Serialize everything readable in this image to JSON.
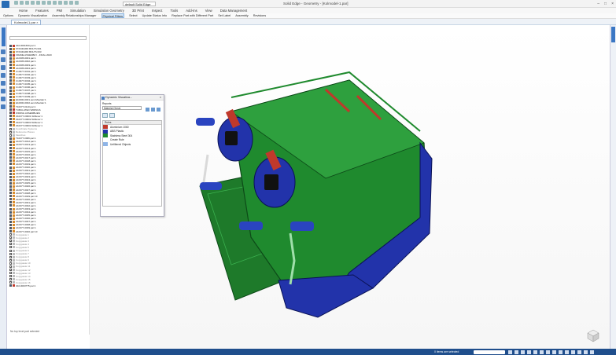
{
  "window": {
    "title": "Solid Edge - Geometry - [Kolmodel-1.par]",
    "doc_selector": "default Solid Edge"
  },
  "menu": [
    "Home",
    "Features",
    "PMI",
    "Simulation",
    "Simulation Geometry",
    "3D Print",
    "Inspect",
    "Tools",
    "Add-Ins",
    "View",
    "Data Management"
  ],
  "ribbon": [
    "Options",
    "Dynamic Visualization",
    "Assembly Relationships Manager",
    "Physical Filters",
    "Select",
    "Update Status Info",
    "Replace Part with Different Part",
    "Set Label",
    "Assembly",
    "Revisions"
  ],
  "doc_tab": "Kolmodel-1.par",
  "pathfinder": {
    "search_placeholder": "",
    "status": "No top level part selected",
    "tree": [
      {
        "t": "402-0001660.par:1",
        "s": "red",
        "c": true
      },
      {
        "t": "STANDARD BOLTS 001",
        "s": "",
        "c": true
      },
      {
        "t": "STANDARD BOLTS 003",
        "s": "",
        "c": true
      },
      {
        "t": "FRAME ASSEMBLY - FINAL 2020",
        "s": "red",
        "c": true
      },
      {
        "t": "A10305-0001.par:1",
        "s": "",
        "c": true
      },
      {
        "t": "A10305-0002.par:1",
        "s": "",
        "c": true
      },
      {
        "t": "A10305-0003.par:1",
        "s": "",
        "c": true
      },
      {
        "t": "A10305-0004.par:1",
        "s": "",
        "c": true
      },
      {
        "t": "C10377-0001.par:1",
        "s": "",
        "c": true
      },
      {
        "t": "C10377-0002.par:1",
        "s": "",
        "c": true
      },
      {
        "t": "C10377-0003.par:1",
        "s": "",
        "c": true
      },
      {
        "t": "C10377-0004.par:1",
        "s": "",
        "c": true
      },
      {
        "t": "C10377-0005.par:1",
        "s": "",
        "c": true
      },
      {
        "t": "C10377-0006.par:1",
        "s": "",
        "c": true
      },
      {
        "t": "C10377-0007.par:1",
        "s": "",
        "c": true
      },
      {
        "t": "C10377-0008.par:1",
        "s": "",
        "c": true
      },
      {
        "t": "C10377-0009.par:1",
        "s": "",
        "c": true
      },
      {
        "t": "E10000-0001.asm:Moulder:1",
        "s": "",
        "c": true
      },
      {
        "t": "E10000-0002.asm:Moulder:1",
        "s": "",
        "c": true
      },
      {
        "t": "T10377-0110.par:1",
        "s": "",
        "c": true
      },
      {
        "t": "TUBULATED WIRINGS",
        "s": "red",
        "c": true
      },
      {
        "t": "WIRING ASSEMBLIES",
        "s": "red",
        "c": true
      },
      {
        "t": "Z10377-00001.Stiffener:1",
        "s": "",
        "c": true
      },
      {
        "t": "Z10377-00002.Stiffener:1",
        "s": "",
        "c": true
      },
      {
        "t": "Z10377-00003.Stiffener:1",
        "s": "",
        "c": true
      },
      {
        "t": "Z10377-00004.Stiffener:1",
        "s": "",
        "c": true
      },
      {
        "t": "Coordinate Systems",
        "s": "grey",
        "c": false
      },
      {
        "t": "Reference Planes",
        "s": "grey",
        "c": false
      },
      {
        "t": "Sketches",
        "s": "grey",
        "c": false
      },
      {
        "t": "T10377-0006.par:1",
        "s": "",
        "c": true
      },
      {
        "t": "A10377-0012.par:1",
        "s": "",
        "c": true
      },
      {
        "t": "A10377-0013.par:1",
        "s": "",
        "c": true
      },
      {
        "t": "A10377-0014.par:1",
        "s": "",
        "c": true
      },
      {
        "t": "A10377-0015.par:1",
        "s": "",
        "c": true
      },
      {
        "t": "A10377-0016.par:1",
        "s": "",
        "c": true
      },
      {
        "t": "A10377-0017.par:1",
        "s": "",
        "c": true
      },
      {
        "t": "A10377-0018.par:1",
        "s": "",
        "c": true
      },
      {
        "t": "A10377-0019.par:1",
        "s": "",
        "c": true
      },
      {
        "t": "A10377-0020.par:1",
        "s": "",
        "c": true
      },
      {
        "t": "A10377-0021.par:1",
        "s": "",
        "c": true
      },
      {
        "t": "A10377-0022.par:1",
        "s": "",
        "c": true
      },
      {
        "t": "A10377-0023.par:1",
        "s": "",
        "c": true
      },
      {
        "t": "A10377-0024.par:1",
        "s": "",
        "c": true
      },
      {
        "t": "A10377-0025.par:1",
        "s": "",
        "c": true
      },
      {
        "t": "A10377-0026.par:1",
        "s": "",
        "c": true
      },
      {
        "t": "A10377-0027.par:1",
        "s": "",
        "c": true
      },
      {
        "t": "A10377-0028.par:1",
        "s": "",
        "c": true
      },
      {
        "t": "A10377-0029.par:10",
        "s": "",
        "c": true
      },
      {
        "t": "A10377-0030.par:1",
        "s": "",
        "c": true
      },
      {
        "t": "A10377-0031.par:1",
        "s": "",
        "c": true
      },
      {
        "t": "A10377-0032.par:1",
        "s": "",
        "c": true
      },
      {
        "t": "A10377-0033.par:1",
        "s": "",
        "c": true
      },
      {
        "t": "A10377-0034.par:1",
        "s": "",
        "c": true
      },
      {
        "t": "A10377-0035.par:1",
        "s": "",
        "c": true
      },
      {
        "t": "A10377-0036.par:1",
        "s": "",
        "c": true
      },
      {
        "t": "A10377-0037.par:1",
        "s": "",
        "c": true
      },
      {
        "t": "A10377-0038.par:1",
        "s": "",
        "c": true
      },
      {
        "t": "A10377-0039.par:1",
        "s": "",
        "c": true
      },
      {
        "t": "A10377-0040.par:10",
        "s": "",
        "c": true
      },
      {
        "t": "Copypaste 1",
        "s": "grey",
        "c": false
      },
      {
        "t": "Copypaste 2",
        "s": "grey",
        "c": false
      },
      {
        "t": "Copypaste 3",
        "s": "grey",
        "c": false
      },
      {
        "t": "Copypaste 4",
        "s": "grey",
        "c": false
      },
      {
        "t": "Copypaste 5",
        "s": "grey",
        "c": false
      },
      {
        "t": "Copypaste 6",
        "s": "grey",
        "c": false
      },
      {
        "t": "Copypaste 7",
        "s": "grey",
        "c": false
      },
      {
        "t": "Copypaste 8",
        "s": "grey",
        "c": false
      },
      {
        "t": "Copypaste 9",
        "s": "grey",
        "c": false
      },
      {
        "t": "Copypaste 10",
        "s": "grey",
        "c": false
      },
      {
        "t": "Copypaste 11",
        "s": "grey",
        "c": false
      },
      {
        "t": "Copypaste 12",
        "s": "grey",
        "c": false
      },
      {
        "t": "Copypaste 13",
        "s": "grey",
        "c": false
      },
      {
        "t": "Copypaste 14",
        "s": "grey",
        "c": false
      },
      {
        "t": "Copypaste 15",
        "s": "grey",
        "c": false
      },
      {
        "t": "Copypaste 16",
        "s": "grey",
        "c": false
      },
      {
        "t": "402-0003775.par:1",
        "s": "red",
        "c": true
      }
    ]
  },
  "dynamic_panel": {
    "title": "Dynamic Visualiza...",
    "reports_label": "Reports",
    "report_value": "Material Check",
    "list_header": "Rules",
    "items": [
      {
        "label": "Aluminium 1060",
        "color": "#c0392b"
      },
      {
        "label": "ABS Plastic",
        "color": "#2233aa"
      },
      {
        "label": "Stainless Steel 304",
        "color": "#1f8a2e"
      },
      {
        "label": "Create Rule",
        "color": ""
      },
      {
        "label": "Unfiltered Objects",
        "color": "#8fb4e6"
      }
    ]
  },
  "status": {
    "message": "0 items are selected"
  },
  "colors": {
    "accent": "#1f4e8c",
    "green_body": "#1f8a2e",
    "blue_parts": "#2233aa",
    "red_parts": "#c0392b"
  }
}
